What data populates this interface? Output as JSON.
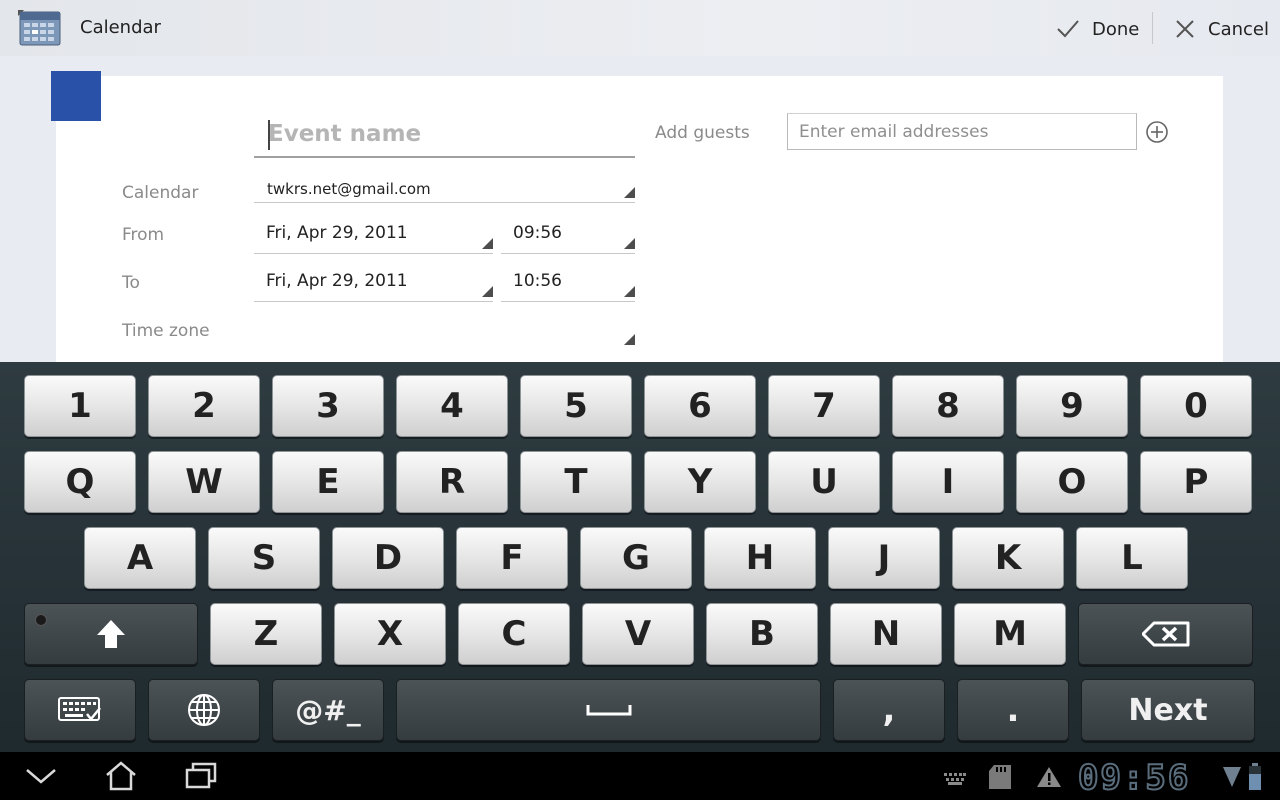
{
  "action_bar": {
    "app_title": "Calendar",
    "app_icon": "calendar-icon",
    "done_label": "Done",
    "cancel_label": "Cancel"
  },
  "form": {
    "event_name_placeholder": "Event name",
    "calendar_label": "Calendar",
    "calendar_value": "twkrs.net@gmail.com",
    "from_label": "From",
    "from_date": "Fri, Apr 29, 2011",
    "from_time": "09:56",
    "to_label": "To",
    "to_date": "Fri, Apr 29, 2011",
    "to_time": "10:56",
    "timezone_label": "Time zone",
    "timezone_value": "",
    "guests_label": "Add guests",
    "guests_placeholder": "Enter email addresses",
    "calendar_color": "#2951a8"
  },
  "keyboard": {
    "row1": [
      "1",
      "2",
      "3",
      "4",
      "5",
      "6",
      "7",
      "8",
      "9",
      "0"
    ],
    "row2": [
      "Q",
      "W",
      "E",
      "R",
      "T",
      "Y",
      "U",
      "I",
      "O",
      "P"
    ],
    "row3": [
      "A",
      "S",
      "D",
      "F",
      "G",
      "H",
      "J",
      "K",
      "L"
    ],
    "row4": [
      "Z",
      "X",
      "C",
      "V",
      "B",
      "N",
      "M"
    ],
    "symbols_label": "@#_",
    "comma_label": ",",
    "period_label": ".",
    "next_label": "Next",
    "icons": [
      "shift-icon",
      "backspace-icon",
      "keyboard-settings-icon",
      "globe-icon",
      "space-icon"
    ]
  },
  "system_bar": {
    "clock": "09:56",
    "icons": [
      "back-icon",
      "home-icon",
      "recent-apps-icon",
      "keyboard-status-icon",
      "sd-card-icon",
      "warning-icon",
      "wifi-icon",
      "battery-icon"
    ]
  }
}
